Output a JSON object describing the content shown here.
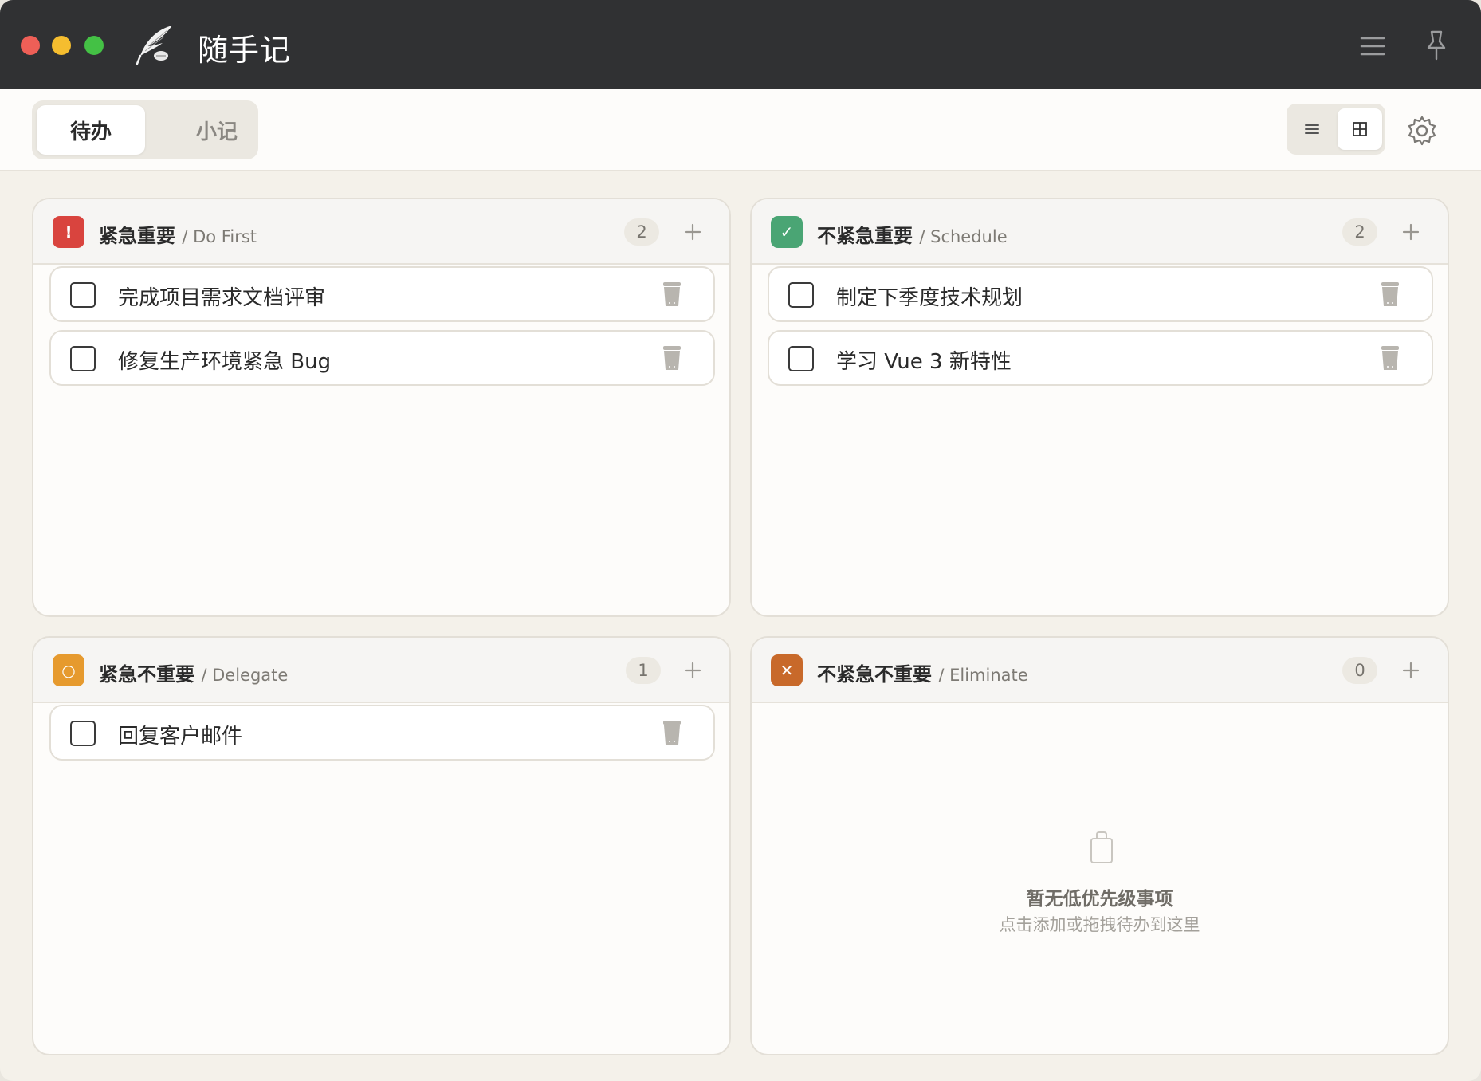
{
  "window": {
    "app_title": "随手记"
  },
  "toolbar": {
    "tabs": [
      {
        "label": "待办",
        "active": true
      },
      {
        "label": "小记",
        "active": false
      }
    ],
    "view_mode": "grid"
  },
  "quadrants": [
    {
      "title": "紧急重要",
      "subtitle": "/ Do First",
      "badge_glyph": "!",
      "badge_color": "#d9443e",
      "count": "2",
      "tasks": [
        "完成项目需求文档评审",
        "修复生产环境紧急 Bug"
      ]
    },
    {
      "title": "不紧急重要",
      "subtitle": "/ Schedule",
      "badge_glyph": "✓",
      "badge_color": "#4aa574",
      "count": "2",
      "tasks": [
        "制定下季度技术规划",
        "学习 Vue 3 新特性"
      ]
    },
    {
      "title": "紧急不重要",
      "subtitle": "/ Delegate",
      "badge_glyph": "○",
      "badge_color": "#e69a2e",
      "count": "1",
      "tasks": [
        "回复客户邮件"
      ]
    },
    {
      "title": "不紧急不重要",
      "subtitle": "/ Eliminate",
      "badge_glyph": "✕",
      "badge_color": "#c8692a",
      "count": "0",
      "tasks": [],
      "empty_title": "暂无低优先级事项",
      "empty_subtitle": "点击添加或拖拽待办到这里"
    }
  ],
  "icons": {
    "menu": "menu-icon",
    "pin": "pin-icon",
    "list_view": "list-view-icon",
    "grid_view": "grid-view-icon",
    "settings": "gear-icon",
    "add": "plus-icon",
    "delete": "trash-icon",
    "empty": "empty-bin-icon"
  }
}
